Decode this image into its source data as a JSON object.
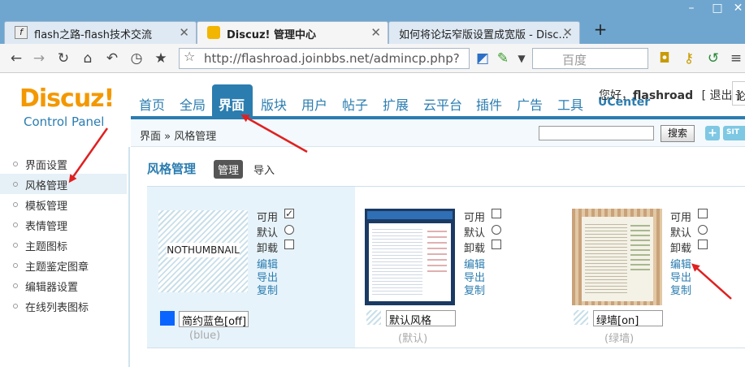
{
  "browser": {
    "tabs": [
      {
        "title": "flash之路-flash技术交流"
      },
      {
        "title": "Discuz! 管理中心"
      },
      {
        "title": "如何将论坛窄版设置成宽版 - Disc..."
      }
    ],
    "url_text": "http://flashroad.joinbbs.net/admincp.php?",
    "search_placeholder": "百度",
    "new_tab_label": "+"
  },
  "header": {
    "logo_text": "Discuz!",
    "logo_sub": "Control Panel",
    "nav": [
      "首页",
      "全局",
      "界面",
      "版块",
      "用户",
      "帖子",
      "扩展",
      "云平台",
      "插件",
      "广告",
      "工具",
      "UCenter"
    ],
    "active_nav": "界面",
    "greeting": "您好，",
    "username": "flashroad",
    "logout": "[ 退出 ]",
    "right_cut": "论"
  },
  "crumb": {
    "text": "界面 » 风格管理",
    "search_button": "搜索",
    "plus": "+",
    "site": "SIT"
  },
  "sidebar": {
    "items": [
      "界面设置",
      "风格管理",
      "模板管理",
      "表情管理",
      "主题图标",
      "主题鉴定图章",
      "编辑器设置",
      "在线列表图标"
    ],
    "active": "风格管理"
  },
  "content": {
    "title": "风格管理",
    "tab_manage": "管理",
    "tab_import": "导入",
    "opt_enable": "可用",
    "opt_default": "默认",
    "opt_uninstall": "卸载",
    "link_edit": "编辑",
    "link_export": "导出",
    "link_copy": "复制",
    "styles": [
      {
        "thumb_text": "NOTHUMBNAIL",
        "name_value": "简约蓝色[off]",
        "sub": "(blue)",
        "swatch": "#0a64ff",
        "enabled": true
      },
      {
        "thumb_text": "",
        "name_value": "默认风格",
        "sub": "(默认)",
        "swatch": "hatch",
        "enabled": false
      },
      {
        "thumb_text": "",
        "name_value": "绿墙[on]",
        "sub": "(绿墙)",
        "swatch": "hatch",
        "enabled": false
      }
    ]
  },
  "colors": {
    "accent": "#2b7db0",
    "logo": "#f39800",
    "arrow": "#e02020"
  }
}
